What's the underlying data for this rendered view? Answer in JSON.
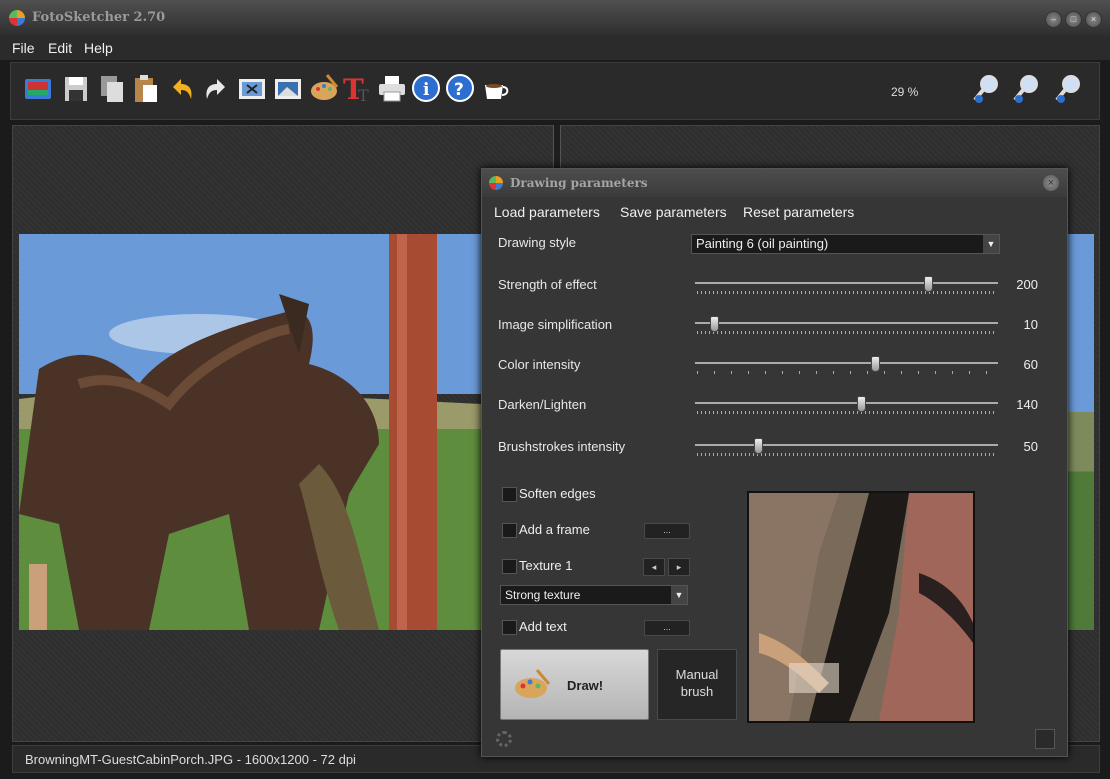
{
  "window": {
    "title": "FotoSketcher 2.70"
  },
  "menu": {
    "file": "File",
    "edit": "Edit",
    "help": "Help"
  },
  "toolbar": {
    "zoom_level": "29 %",
    "icons": [
      "open-image-icon",
      "save-icon",
      "copy-icon",
      "paste-icon",
      "undo-icon",
      "redo-icon",
      "crop-icon",
      "image-adjust-icon",
      "palette-icon",
      "text-icon",
      "print-icon",
      "info-icon",
      "help-icon",
      "coffee-icon",
      "zoom-out-icon",
      "zoom-fit-icon",
      "zoom-in-icon"
    ]
  },
  "status": {
    "text": "BrowningMT-GuestCabinPorch.JPG - 1600x1200 - 72 dpi"
  },
  "dialog": {
    "title": "Drawing parameters",
    "menu": {
      "load": "Load parameters",
      "save": "Save parameters",
      "reset": "Reset parameters"
    },
    "drawing_style": {
      "label": "Drawing style",
      "value": "Painting 6 (oil painting)"
    },
    "sliders": [
      {
        "label": "Strength of effect",
        "value": "200",
        "level": 0.78
      },
      {
        "label": "Image simplification",
        "value": "10",
        "level": 0.05
      },
      {
        "label": "Color intensity",
        "value": "60",
        "level": 0.6
      },
      {
        "label": "Darken/Lighten",
        "value": "140",
        "level": 0.55
      },
      {
        "label": "Brushstrokes intensity",
        "value": "50",
        "level": 0.2
      }
    ],
    "options": {
      "soften_edges": "Soften edges",
      "add_frame": "Add a frame",
      "texture": "Texture 1",
      "texture_type": "Strong texture",
      "add_text": "Add text",
      "ellipsis": "...",
      "prev": "◂",
      "next": "▸"
    },
    "draw_button": "Draw!",
    "manual_brush_line1": "Manual",
    "manual_brush_line2": "brush"
  },
  "colors": {
    "accent": "#3a7bd5",
    "window_bg": "#1b1b1b",
    "dialog_bg": "#363636"
  }
}
